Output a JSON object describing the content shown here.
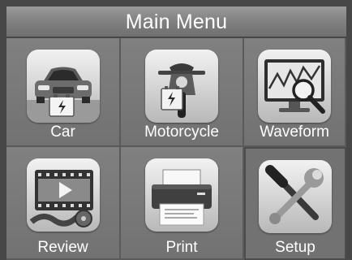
{
  "header": {
    "title": "Main Menu"
  },
  "menu": {
    "items": [
      {
        "label": "Car",
        "icon": "car-icon"
      },
      {
        "label": "Motorcycle",
        "icon": "motorcycle-icon"
      },
      {
        "label": "Waveform",
        "icon": "waveform-icon"
      },
      {
        "label": "Review",
        "icon": "film-review-icon"
      },
      {
        "label": "Print",
        "icon": "printer-icon"
      },
      {
        "label": "Setup",
        "icon": "wrench-screwdriver-icon"
      }
    ]
  },
  "colors": {
    "background": "#474747",
    "tile": "#7a7a7a",
    "text": "#ffffff"
  }
}
